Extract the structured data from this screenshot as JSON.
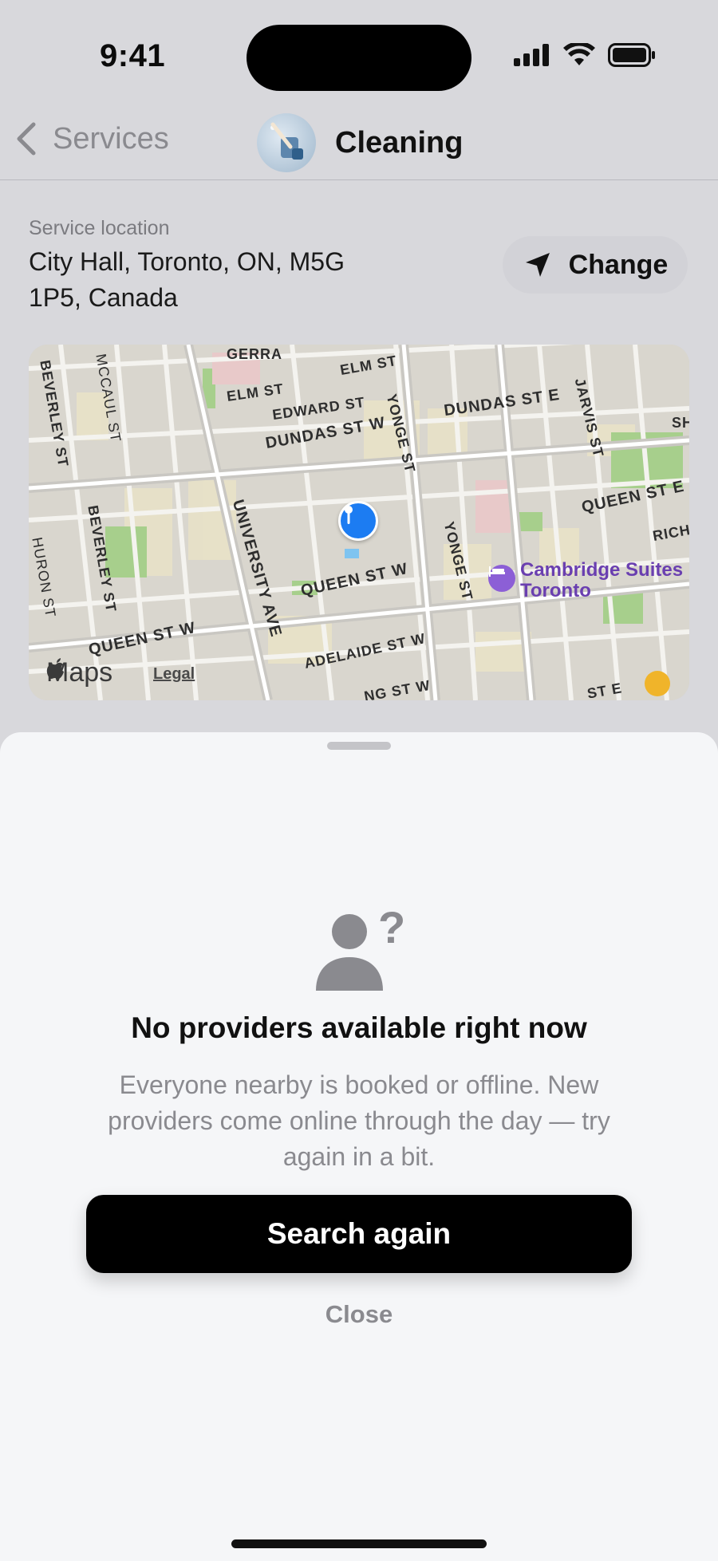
{
  "status_bar": {
    "time": "9:41"
  },
  "nav": {
    "back_label": "Services",
    "title": "Cleaning"
  },
  "location": {
    "label": "Service location",
    "address": "City Hall, Toronto, ON, M5G 1P5, Canada",
    "change_label": "Change"
  },
  "map": {
    "provider_label": "Maps",
    "legal_label": "Legal",
    "poi": "Cambridge Suites Toronto",
    "streets": {
      "gerrard": "GERRA",
      "elm_top": "ELM ST",
      "elm": "ELM ST",
      "edward": "EDWARD ST",
      "dundas_w": "DUNDAS ST W",
      "dundas_e": "DUNDAS ST E",
      "yonge_top": "YONGE ST",
      "yonge_bottom": "YONGE ST",
      "jarvis": "JARVIS ST",
      "beverley_top": "BEVERLEY ST",
      "beverley": "BEVERLEY ST",
      "mccaul": "MCCAUL ST",
      "huron": "HURON ST",
      "university": "UNIVERSITY AVE",
      "queen_w": "QUEEN ST W",
      "queen_w_left": "QUEEN ST W",
      "queen_e": "QUEEN ST E",
      "adelaide": "ADELAIDE ST W",
      "king": "NG ST W",
      "rich": "RICH",
      "sh": "SH",
      "st_e": "ST E"
    }
  },
  "sheet": {
    "title": "No providers available right now",
    "description": "Everyone nearby is booked or offline. New providers come online through the day — try again in a bit.",
    "primary_button": "Search again",
    "secondary_button": "Close"
  },
  "colors": {
    "accent": "#000000",
    "pin": "#1c7cf2",
    "poi": "#8c5fd6",
    "muted_text": "#8a8a8f"
  }
}
